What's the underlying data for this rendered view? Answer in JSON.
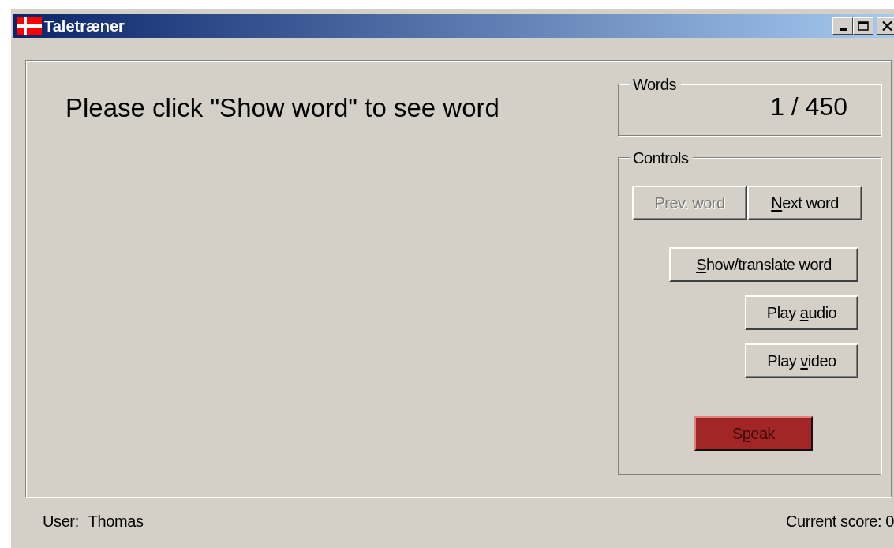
{
  "window": {
    "title": "Taletræner",
    "controls": [
      {
        "kind": "minimize"
      },
      {
        "kind": "maximize"
      },
      {
        "kind": "close"
      }
    ]
  },
  "prompt": "Please click \"Show word\" to see word",
  "words": {
    "label": "Words",
    "counter": "1 / 450"
  },
  "controls": {
    "label": "Controls",
    "buttons": [
      {
        "kind": "nav",
        "label": [
          {
            "text": "Prev. word",
            "underlined": false
          }
        ],
        "disabled": true
      },
      {
        "kind": "nav",
        "label": [
          {
            "text": "N",
            "underlined": true
          },
          {
            "text": "ext word",
            "underlined": false
          }
        ],
        "disabled": false
      },
      {
        "kind": "wide",
        "label": [
          {
            "text": "S",
            "underlined": true
          },
          {
            "text": "how/translate word",
            "underlined": false
          }
        ],
        "disabled": false
      },
      {
        "kind": "small",
        "label": [
          {
            "text": "Play ",
            "underlined": false
          },
          {
            "text": "a",
            "underlined": true
          },
          {
            "text": "udio",
            "underlined": false
          }
        ],
        "disabled": false
      },
      {
        "kind": "small",
        "label": [
          {
            "text": "Play ",
            "underlined": false
          },
          {
            "text": "v",
            "underlined": true
          },
          {
            "text": "ideo",
            "underlined": false
          }
        ],
        "disabled": false
      },
      {
        "kind": "speak",
        "label": [
          {
            "text": "S",
            "underlined": false
          },
          {
            "text": "p",
            "underlined": true
          },
          {
            "text": "eak",
            "underlined": false
          }
        ],
        "disabled": false
      }
    ]
  },
  "status_bar": {
    "user_label": "User:",
    "user": "Thomas",
    "score": "Current score: 0"
  }
}
